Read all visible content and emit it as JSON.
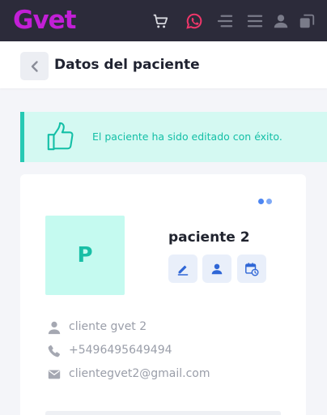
{
  "app": {
    "logo_text": "Gvet",
    "brand_color": "#c21fd6"
  },
  "topbar_icons": [
    "cart-icon",
    "whatsapp-icon",
    "menu-indent-icon",
    "hamburger-menu-icon",
    "user-icon",
    "windows-icon"
  ],
  "header": {
    "title": "Datos del paciente",
    "back_icon": "chevron-left-icon"
  },
  "alert": {
    "icon": "thumbs-up-icon",
    "message": "El paciente ha sido editado con éxito.",
    "color": "#13bfa6",
    "background": "#d4f9f2"
  },
  "patient": {
    "initial": "P",
    "name": "paciente 2",
    "actions": [
      "edit-icon",
      "user-icon",
      "calendar-clock-icon"
    ],
    "owner": "cliente gvet 2",
    "phone": "+5496495649494",
    "email": "clientegvet2@gmail.com"
  }
}
